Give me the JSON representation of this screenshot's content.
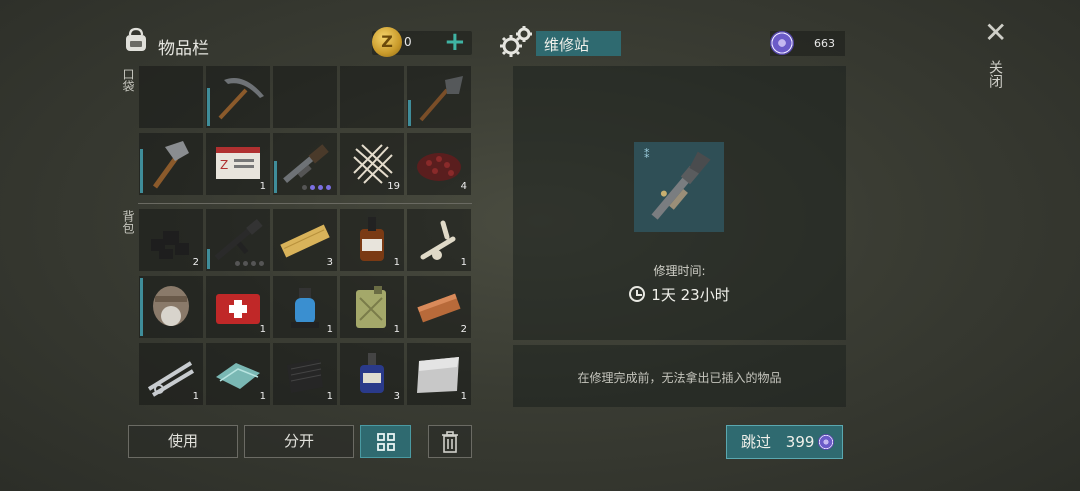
{
  "header": {
    "inventory_title": "物品栏",
    "coin_letter": "Z",
    "coins": "0",
    "plus": "+",
    "station_title": "维修站",
    "chips": "663"
  },
  "close": {
    "icon": "✕",
    "label": "关闭"
  },
  "sections": {
    "pocket": "口袋",
    "backpack": "背包"
  },
  "pocket": [
    {
      "name": "empty",
      "count": "",
      "durability": 0
    },
    {
      "name": "pickaxe",
      "count": "",
      "durability": 0.65
    },
    {
      "name": "empty",
      "count": "",
      "durability": 0
    },
    {
      "name": "empty",
      "count": "",
      "durability": 0
    },
    {
      "name": "shovel",
      "count": "",
      "durability": 0.45
    },
    {
      "name": "hatchet",
      "count": "",
      "durability": 0.75
    },
    {
      "name": "id-card",
      "count": "1",
      "durability": 0
    },
    {
      "name": "shotgun",
      "count": "",
      "durability": 0.55,
      "mods": [
        false,
        true,
        true,
        true
      ]
    },
    {
      "name": "cloth",
      "count": "19",
      "durability": 0
    },
    {
      "name": "berries",
      "count": "4",
      "durability": 0
    }
  ],
  "backpack": [
    {
      "name": "coal",
      "count": "2",
      "durability": 0
    },
    {
      "name": "rifle",
      "count": "",
      "durability": 0.35,
      "mods": [
        false,
        false,
        false,
        false
      ]
    },
    {
      "name": "wood-plank",
      "count": "3",
      "durability": 0
    },
    {
      "name": "whiskey",
      "count": "1",
      "durability": 0
    },
    {
      "name": "bones",
      "count": "1",
      "durability": 0
    },
    {
      "name": "fur-hat",
      "count": "",
      "durability": 1.0
    },
    {
      "name": "first-aid-kit",
      "count": "1",
      "durability": 0
    },
    {
      "name": "water-pump",
      "count": "1",
      "durability": 0
    },
    {
      "name": "jerrycan",
      "count": "1",
      "durability": 0
    },
    {
      "name": "copper-bar",
      "count": "2",
      "durability": 0
    },
    {
      "name": "pipes",
      "count": "1",
      "durability": 0
    },
    {
      "name": "glass",
      "count": "1",
      "durability": 0
    },
    {
      "name": "rubber",
      "count": "1",
      "durability": 0
    },
    {
      "name": "blue-bottle",
      "count": "3",
      "durability": 0
    },
    {
      "name": "metal-sheet",
      "count": "1",
      "durability": 0
    }
  ],
  "buttons": {
    "use": "使用",
    "split": "分开",
    "grid": "grid-icon",
    "trash": "trash-icon"
  },
  "repair": {
    "time_label": "修理时间:",
    "time_value": "1天 23小时",
    "note": "在修理完成前，无法拿出已插入的物品",
    "skip_label": "跳过",
    "skip_cost": "399"
  }
}
